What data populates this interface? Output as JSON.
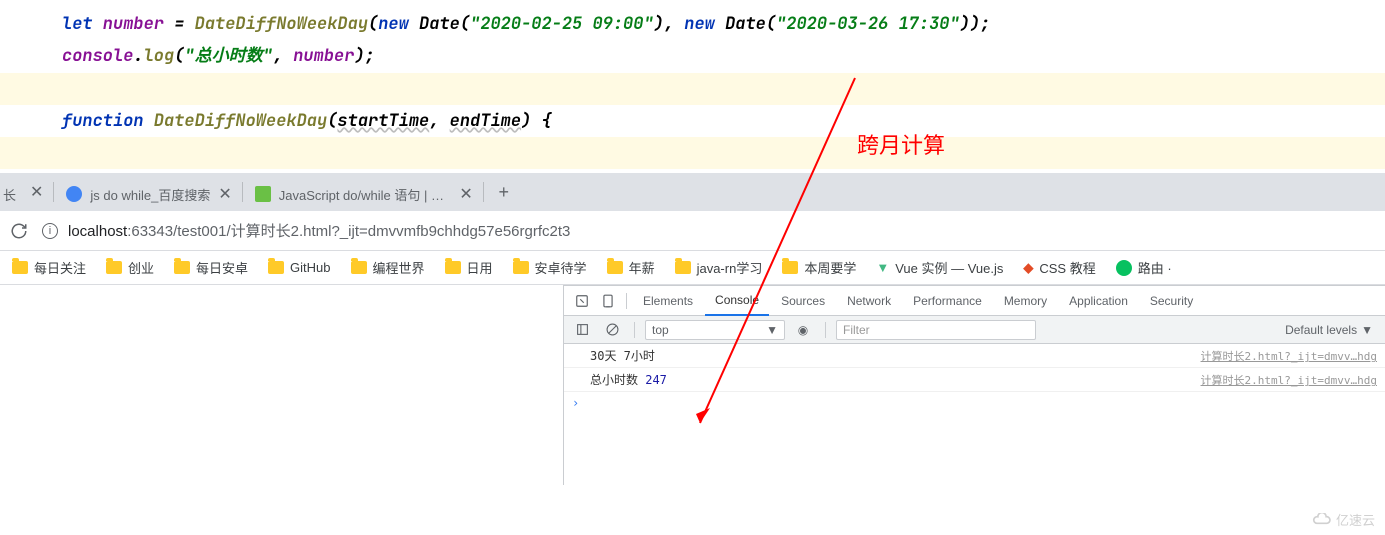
{
  "code": {
    "l1_kw": "let",
    "l1_var": " number",
    "l1_eq": " = ",
    "l1_fn": "DateDiffNoWeekDay",
    "l1_p1": "(",
    "l1_kw2": "new",
    "l1_cls": " Date",
    "l1_p2": "(",
    "l1_str1": "\"2020-02-25 09:00\"",
    "l1_p3": "), ",
    "l1_kw3": "new",
    "l1_cls2": " Date",
    "l1_p4": "(",
    "l1_str2": "\"2020-03-26 17:30\"",
    "l1_p5": "));",
    "l2_var": "console",
    "l2_dot": ".",
    "l2_fn": "log",
    "l2_p1": "(",
    "l2_str": "\"总小时数\"",
    "l2_c": ", ",
    "l2_var2": "number",
    "l2_p2": ");",
    "l4_kw": "function",
    "l4_fn": " DateDiffNoWeekDay",
    "l4_p1": "(",
    "l4_a1": "startTime",
    "l4_c": ", ",
    "l4_a2": "endTime",
    "l4_p2": ") {"
  },
  "annotation": "跨月计算",
  "tabs": {
    "t0_suffix": "长",
    "t1": "js do while_百度搜索",
    "t2": "JavaScript do/while 语句 | 菜鸟"
  },
  "address": {
    "host": "localhost",
    "path": ":63343/test001/计算时长2.html?_ijt=dmvvmfb9chhdg57e56rgrfc2t3"
  },
  "bookmarks": {
    "b0": "每日关注",
    "b1": "创业",
    "b2": "每日安卓",
    "b3": "GitHub",
    "b4": "编程世界",
    "b5": "日用",
    "b6": "安卓待学",
    "b7": "年薪",
    "b8": "java-rn学习",
    "b9": "本周要学",
    "b10": "Vue 实例 — Vue.js",
    "b11": "CSS 教程",
    "b12": "路由 ·"
  },
  "devtools": {
    "tabs": {
      "elements": "Elements",
      "console": "Console",
      "sources": "Sources",
      "network": "Network",
      "performance": "Performance",
      "memory": "Memory",
      "application": "Application",
      "security": "Security"
    },
    "context": "top",
    "filter_ph": "Filter",
    "levels": "Default levels",
    "log1_msg": "30天 7小时",
    "log2_label": "总小时数 ",
    "log2_val": "247",
    "src": "计算时长2.html?_ijt=dmvv…hdg"
  },
  "watermark": "亿速云"
}
